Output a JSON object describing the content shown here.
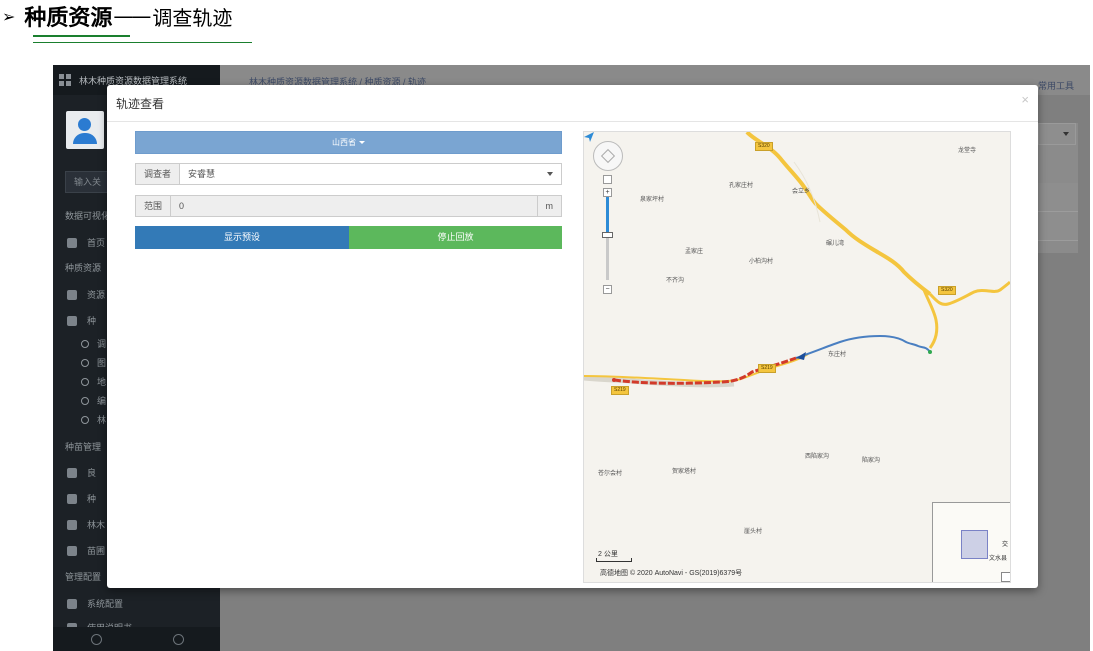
{
  "slide": {
    "bullet": "➢",
    "title_bold": "种质资源",
    "dash": "——",
    "title_rest": "调查轨迹"
  },
  "app": {
    "brand": "林木种质资源数据管理系统",
    "breadcrumb": "林木种质资源数据管理系统 / 种质资源 / 轨迹",
    "tools": "常用工具",
    "search_placeholder": "输入关",
    "sidebar": {
      "sections": [
        "数据可视化",
        "种质资源",
        "种苗管理",
        "管理配置"
      ],
      "items": [
        "首页",
        "资源",
        "种",
        "良",
        "种",
        "林木",
        "苗圃"
      ],
      "subs": [
        "调",
        "图",
        "地",
        "编",
        "林"
      ],
      "bottom_item": "系统配置",
      "bottom_item2": "使用说明书"
    }
  },
  "modal": {
    "title": "轨迹查看",
    "close": "×",
    "province": "山西省",
    "surveyor_label": "调查者",
    "surveyor_value": "安睿慧",
    "range_label": "范围",
    "range_value": "0",
    "range_unit": "m",
    "show_preset": "显示预设",
    "stop_playback": "停止回放"
  },
  "map": {
    "labels": [
      "龙堂寺",
      "孔家庄村",
      "会立乡",
      "泉家坪村",
      "孟家庄",
      "小柏沟村",
      "碾儿湾",
      "不齐沟",
      "东庄村",
      "苍尔会村",
      "贺家塔村",
      "西陷家沟",
      "陷家沟",
      "崖头村",
      "东",
      "文水县",
      "交"
    ],
    "roads": [
      "S320",
      "S320",
      "S219",
      "S219"
    ],
    "scale": "2 公里",
    "copyright": "高德地图 © 2020 AutoNavi - GS(2019)6379号",
    "colors": {
      "track": "#d23a2a",
      "track_played": "#4a7fc1",
      "road": "#f4c53e"
    }
  }
}
